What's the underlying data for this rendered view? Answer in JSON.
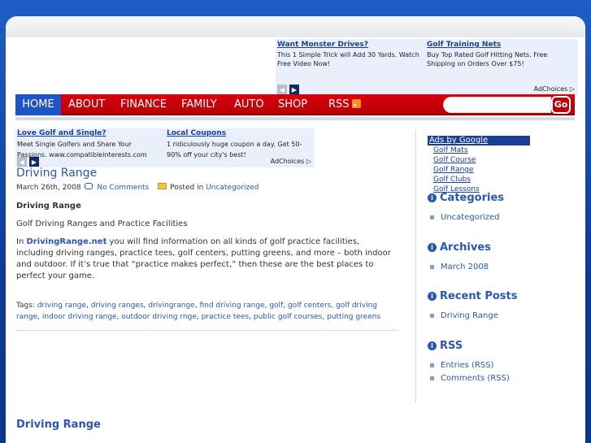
{
  "top_ads": [
    {
      "title": "Want Monster Drives?",
      "text": "This 1 Simple Trick will Add 30 Yards. Watch Free Video Now!"
    },
    {
      "title": "Golf Training Nets",
      "text": "Buy Top Rated Golf Hitting Nets. Free Shipping on Orders Over $75!"
    }
  ],
  "adchoices_label": "AdChoices",
  "nav": {
    "items": [
      "HOME",
      "ABOUT",
      "FINANCE",
      "FAMILY",
      "AUTO",
      "SHOP",
      "RSS"
    ],
    "search_placeholder": "",
    "go_label": "Go"
  },
  "inline_ads": [
    {
      "title": "Love Golf and Single?",
      "text": "Meet Single Golfers and Share Your Passions. www.compatibleinterests.com"
    },
    {
      "title": "Local Coupons",
      "text": "1 ridiculously huge coupon a day. Get 50-90% off your city's best!"
    }
  ],
  "post": {
    "title": "Driving Range",
    "date": "March 26th, 2008",
    "comments": "No Comments",
    "posted_in_label": "Posted in",
    "category": "Uncategorized",
    "heading": "Driving Range",
    "intro": "Golf Driving Ranges and Practice Facilities",
    "body_prefix": "In",
    "site_name": "DrivingRange.net",
    "body_rest": "you will find information on all kinds of golf practice facilities, including driving ranges, practice tees, golf centers, putting greens, and more – both indoor and outdoor. If it’s true that “practice makes perfect,” then these are the best places to perfect your game.",
    "tags_label": "Tags:",
    "tags": [
      "driving range",
      "driving ranges",
      "drivingrange",
      "find driving range",
      "golf",
      "golf centers",
      "golf driving range",
      "indoor driving range",
      "outdoor driving rnge",
      "practice tees",
      "public golf courses",
      "putting greens"
    ]
  },
  "next_post_title": "Driving Range",
  "sidebar": {
    "google_ads_header": "Ads by Google",
    "google_links": [
      "Golf Mats",
      "Golf Course",
      "Golf Range",
      "Golf Clubs",
      "Golf Lessons"
    ],
    "categories_title": "Categories",
    "categories": [
      "Uncategorized"
    ],
    "archives_title": "Archives",
    "archives": [
      "March 2008"
    ],
    "recent_title": "Recent Posts",
    "recent": [
      "Driving Range"
    ],
    "rss_title": "RSS",
    "rss": [
      "Entries (RSS)",
      "Comments (RSS)"
    ]
  }
}
